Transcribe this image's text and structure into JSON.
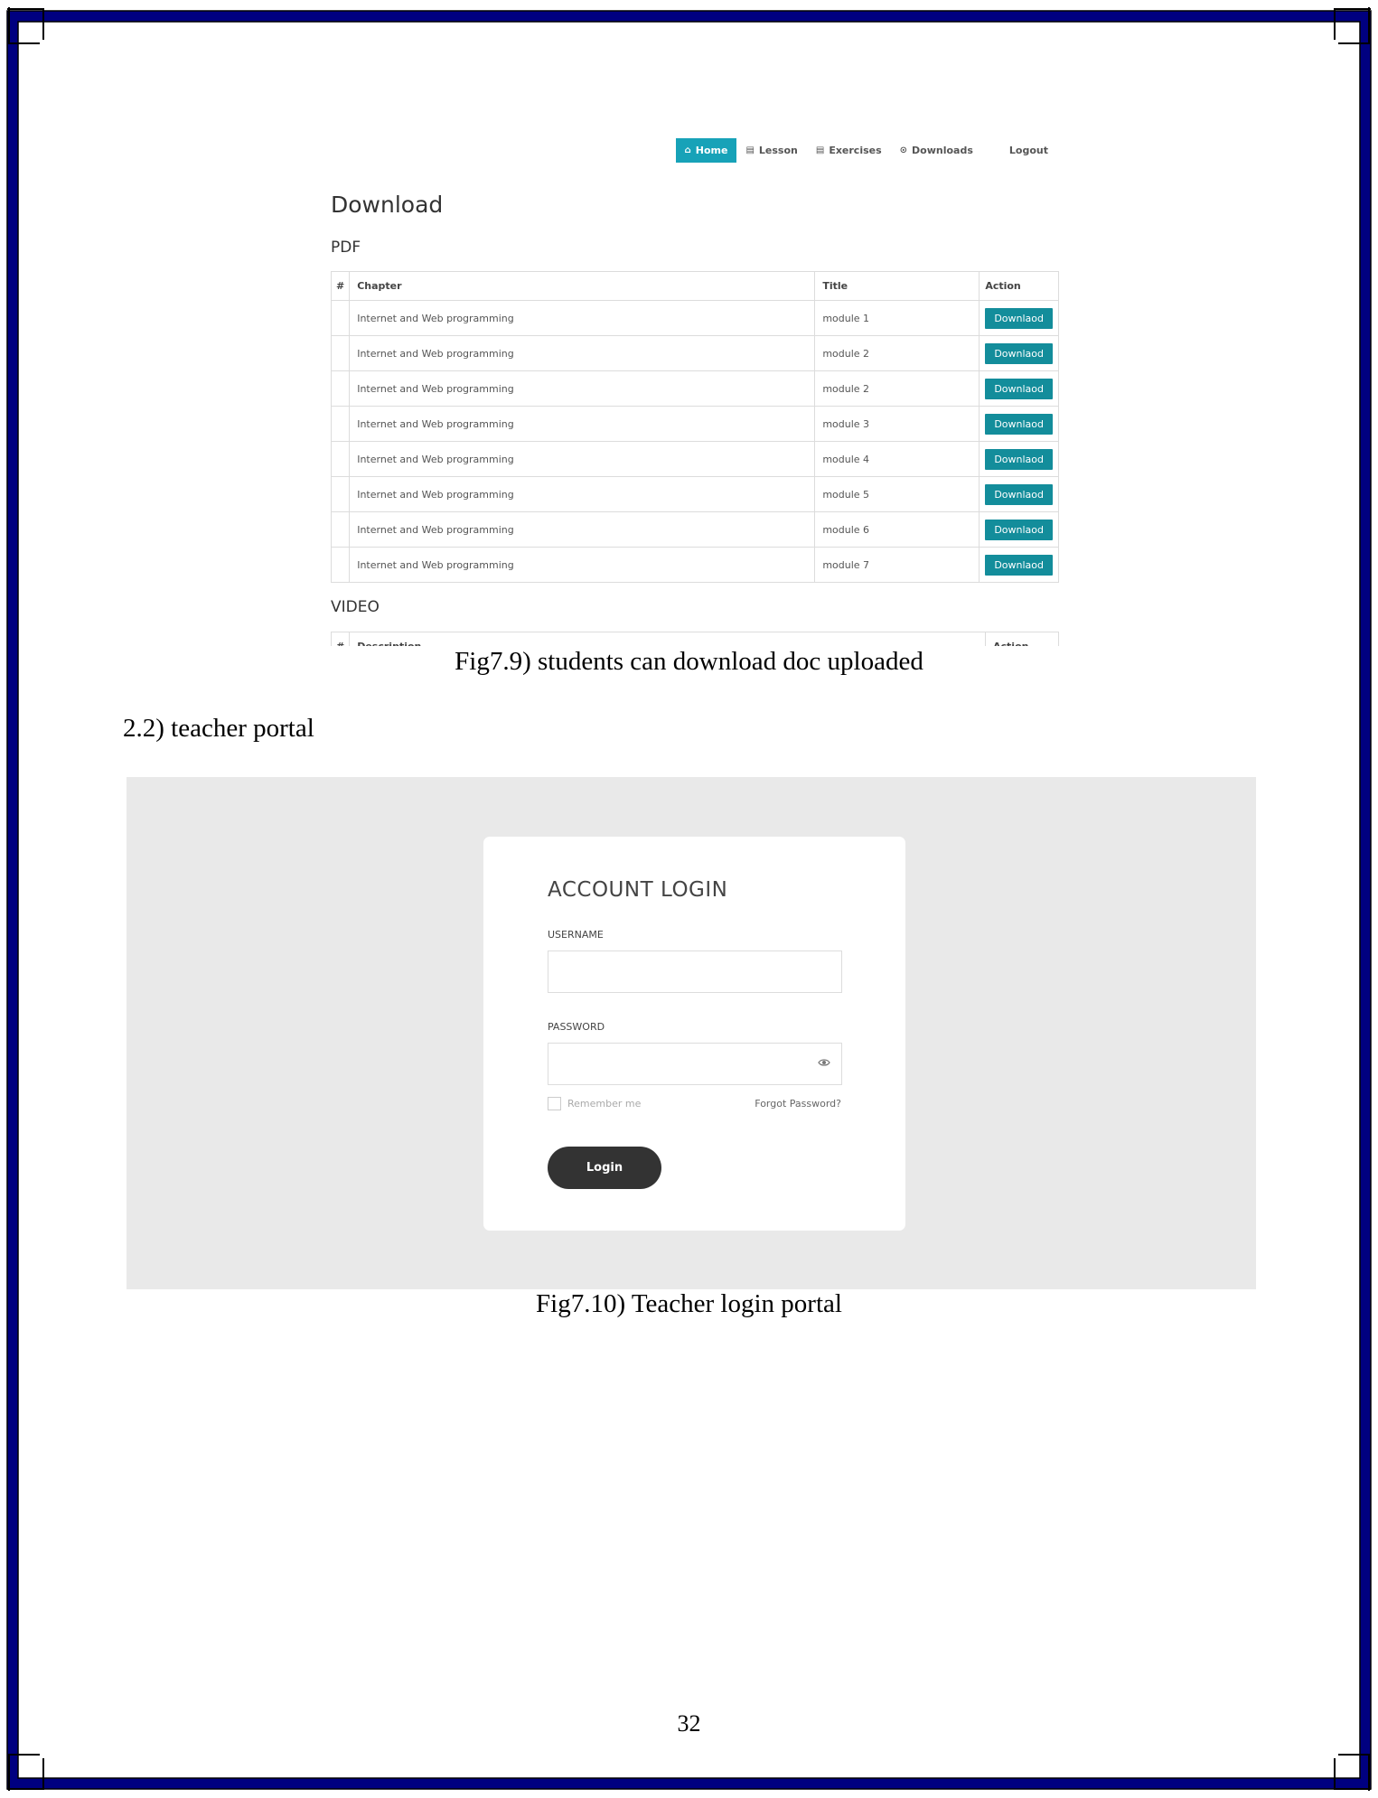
{
  "figure1": {
    "nav": {
      "home": "Home",
      "lesson": "Lesson",
      "exercises": "Exercises",
      "downloads": "Downloads",
      "logout": "Logout"
    },
    "page_title": "Download",
    "pdf_heading": "PDF",
    "table": {
      "headers": [
        "#",
        "Chapter",
        "Title",
        "Action"
      ],
      "rows": [
        {
          "chapter": "Internet and Web programming",
          "title": "module 1",
          "action": "Downlaod"
        },
        {
          "chapter": "Internet and Web programming",
          "title": "module 2",
          "action": "Downlaod"
        },
        {
          "chapter": "Internet and Web programming",
          "title": "module 2",
          "action": "Downlaod"
        },
        {
          "chapter": "Internet and Web programming",
          "title": "module 3",
          "action": "Downlaod"
        },
        {
          "chapter": "Internet and Web programming",
          "title": "module 4",
          "action": "Downlaod"
        },
        {
          "chapter": "Internet and Web programming",
          "title": "module 5",
          "action": "Downlaod"
        },
        {
          "chapter": "Internet and Web programming",
          "title": "module 6",
          "action": "Downlaod"
        },
        {
          "chapter": "Internet and Web programming",
          "title": "module 7",
          "action": "Downlaod"
        }
      ]
    },
    "video_heading": "VIDEO",
    "video_headers": [
      "#",
      "Description",
      "Action"
    ]
  },
  "caption1": "Fig7.9) students can download doc uploaded",
  "section_heading": "2.2) teacher portal",
  "figure2": {
    "title": "ACCOUNT LOGIN",
    "username_label": "USERNAME",
    "username_value": "",
    "password_label": "PASSWORD",
    "password_value": "",
    "remember_label": "Remember me",
    "forgot_label": "Forgot Password?",
    "login_label": "Login"
  },
  "caption2": "Fig7.10) Teacher login portal",
  "page_number": "32",
  "colors": {
    "border": "#000080",
    "nav_active": "#17a2b8",
    "download_button": "#138d9b",
    "login_background": "#e9e9e9",
    "login_button": "#333333"
  }
}
